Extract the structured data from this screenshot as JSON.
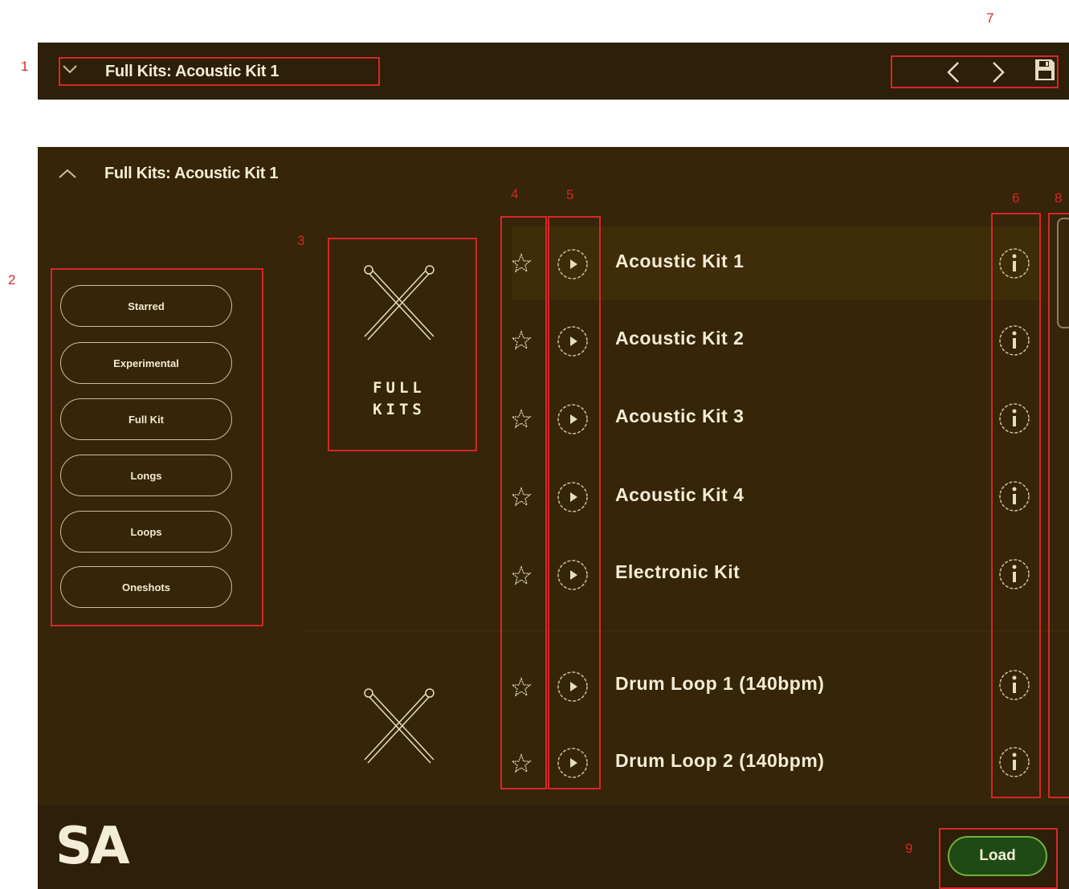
{
  "collapsed_bar": {
    "title": "Full Kits: Acoustic Kit 1",
    "icons": [
      "chevron-down-icon",
      "chevron-left-icon",
      "chevron-right-icon",
      "save-icon"
    ]
  },
  "browser": {
    "header_title": "Full Kits: Acoustic Kit 1",
    "tags": [
      "Starred",
      "Experimental",
      "Full Kit",
      "Longs",
      "Loops",
      "Oneshots"
    ],
    "thumbnail_label_line1": "FULL",
    "thumbnail_label_line2": "KITS",
    "items": [
      {
        "name": "Acoustic Kit 1",
        "selected": true
      },
      {
        "name": "Acoustic Kit 2",
        "selected": false
      },
      {
        "name": "Acoustic Kit 3",
        "selected": false
      },
      {
        "name": "Acoustic Kit 4",
        "selected": false
      },
      {
        "name": "Electronic Kit",
        "selected": false
      },
      {
        "name": "Drum Loop 1 (140bpm)",
        "selected": false
      },
      {
        "name": "Drum Loop 2 (140bpm)",
        "selected": false
      }
    ]
  },
  "footer": {
    "logo": "SA",
    "load_label": "Load"
  },
  "annotations": [
    "1",
    "2",
    "3",
    "4",
    "5",
    "6",
    "7",
    "8",
    "9"
  ],
  "colors": {
    "panel_bg": "#362508",
    "bar_bg": "#2d1f09",
    "text": "#f3ecd6",
    "load_green": "#1f4a15",
    "load_border": "#6fb33c",
    "annotation_red": "#d8262a"
  }
}
